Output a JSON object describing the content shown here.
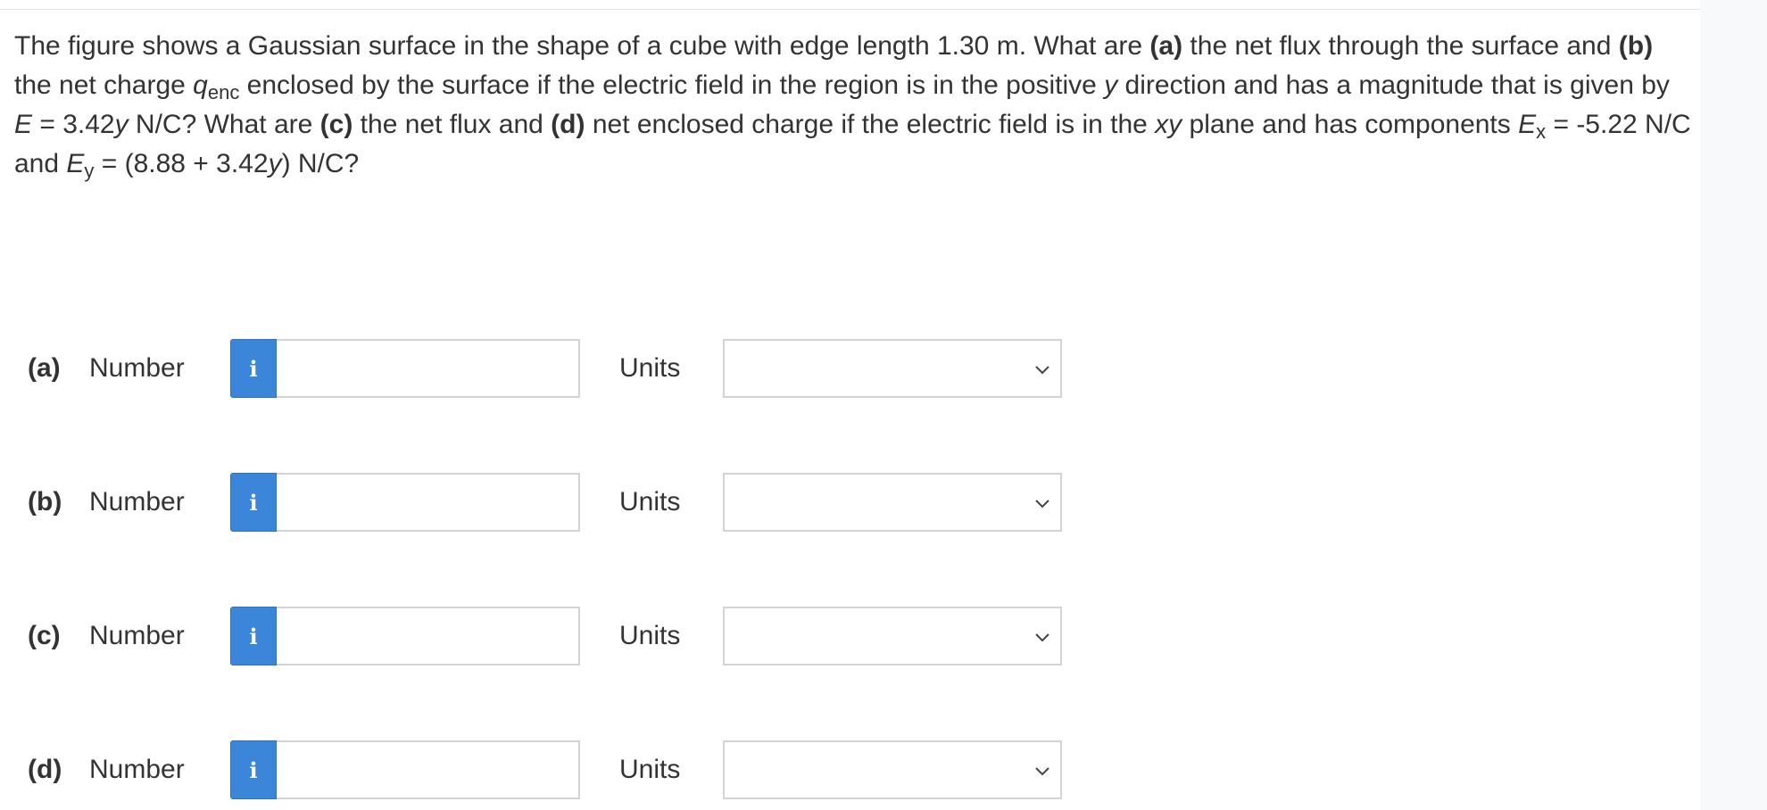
{
  "question": {
    "intro": "The figure shows a Gaussian surface in the shape of a cube with edge length 1.30 m. What are ",
    "a_marker": "(a)",
    "seg1": " the net flux through the surface and ",
    "b_marker": "(b)",
    "seg2": " the net charge ",
    "q_symbol": "q",
    "q_subscript": "enc",
    "seg3": " enclosed by the surface if the electric field in the region is in the positive ",
    "y_var1": "y",
    "seg4": " direction and has a magnitude that is given by ",
    "e_var": "E",
    "seg5": " = 3.42",
    "y_var2": "y",
    "seg6": " N/C? What are ",
    "c_marker": "(c)",
    "seg7": " the net flux and ",
    "d_marker": "(d)",
    "seg8": " net enclosed charge if the electric field is in the ",
    "xy_var": "xy",
    "seg9": " plane and has components ",
    "ex_symbol": "E",
    "ex_subscript": "x",
    "seg10": " = -5.22 N/C and ",
    "ey_symbol": "E",
    "ey_subscript": "y",
    "seg11": " = (8.88 + 3.42",
    "y_var3": "y",
    "seg12": ") N/C?"
  },
  "parts": [
    {
      "label": "(a)",
      "number_label": "Number",
      "info_icon": "i",
      "value": "",
      "units_label": "Units",
      "units_value": ""
    },
    {
      "label": "(b)",
      "number_label": "Number",
      "info_icon": "i",
      "value": "",
      "units_label": "Units",
      "units_value": ""
    },
    {
      "label": "(c)",
      "number_label": "Number",
      "info_icon": "i",
      "value": "",
      "units_label": "Units",
      "units_value": ""
    },
    {
      "label": "(d)",
      "number_label": "Number",
      "info_icon": "i",
      "value": "",
      "units_label": "Units",
      "units_value": ""
    }
  ],
  "colors": {
    "info_button": "#3b86d8",
    "input_border": "#d3d3d3",
    "text": "#333333"
  }
}
